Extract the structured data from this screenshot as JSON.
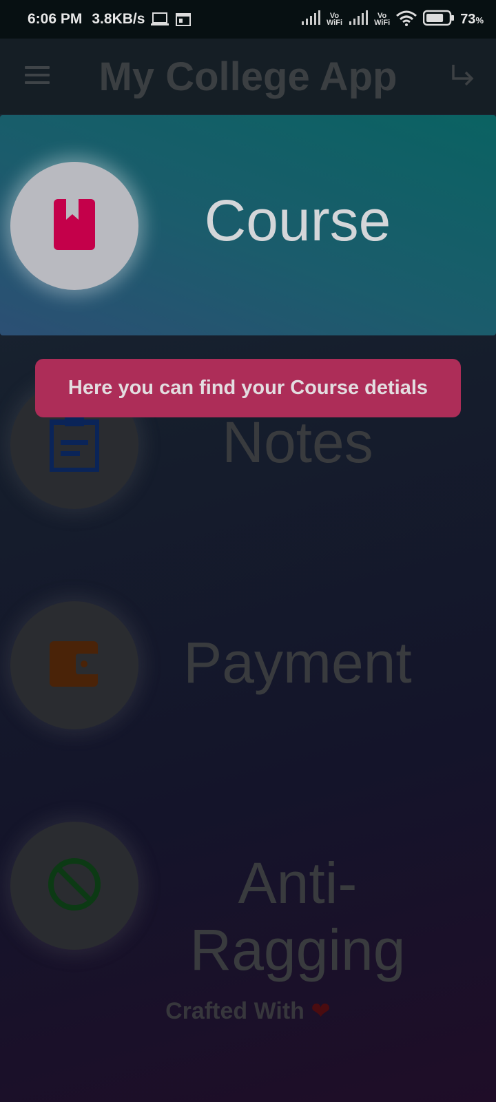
{
  "status_bar": {
    "time": "6:06 PM",
    "net_speed": "3.8KB/s",
    "vowifi_top": "Vo",
    "vowifi_bottom": "WiFi",
    "battery_percent": "73",
    "battery_unit": "%",
    "battery_level": 0.73
  },
  "app_bar": {
    "title": "My College App",
    "menu_icon": "hamburger-menu-icon",
    "action_icon": "logout-arrow-icon"
  },
  "menu_items": [
    {
      "label": "Course",
      "icon": "book-icon",
      "icon_color": "#c4004a"
    },
    {
      "label": "Notes",
      "icon": "clipboard-icon",
      "icon_color": "#0a2458"
    },
    {
      "label": "Payment",
      "icon": "wallet-icon",
      "icon_color": "#4a2308"
    },
    {
      "label": "Anti-Ragging",
      "icon": "prohibited-icon",
      "icon_color": "#0c3a14"
    }
  ],
  "tooltip": {
    "text": "Here you can find your Course detials"
  },
  "footer": {
    "text": "Crafted With",
    "icon": "heart-icon"
  }
}
